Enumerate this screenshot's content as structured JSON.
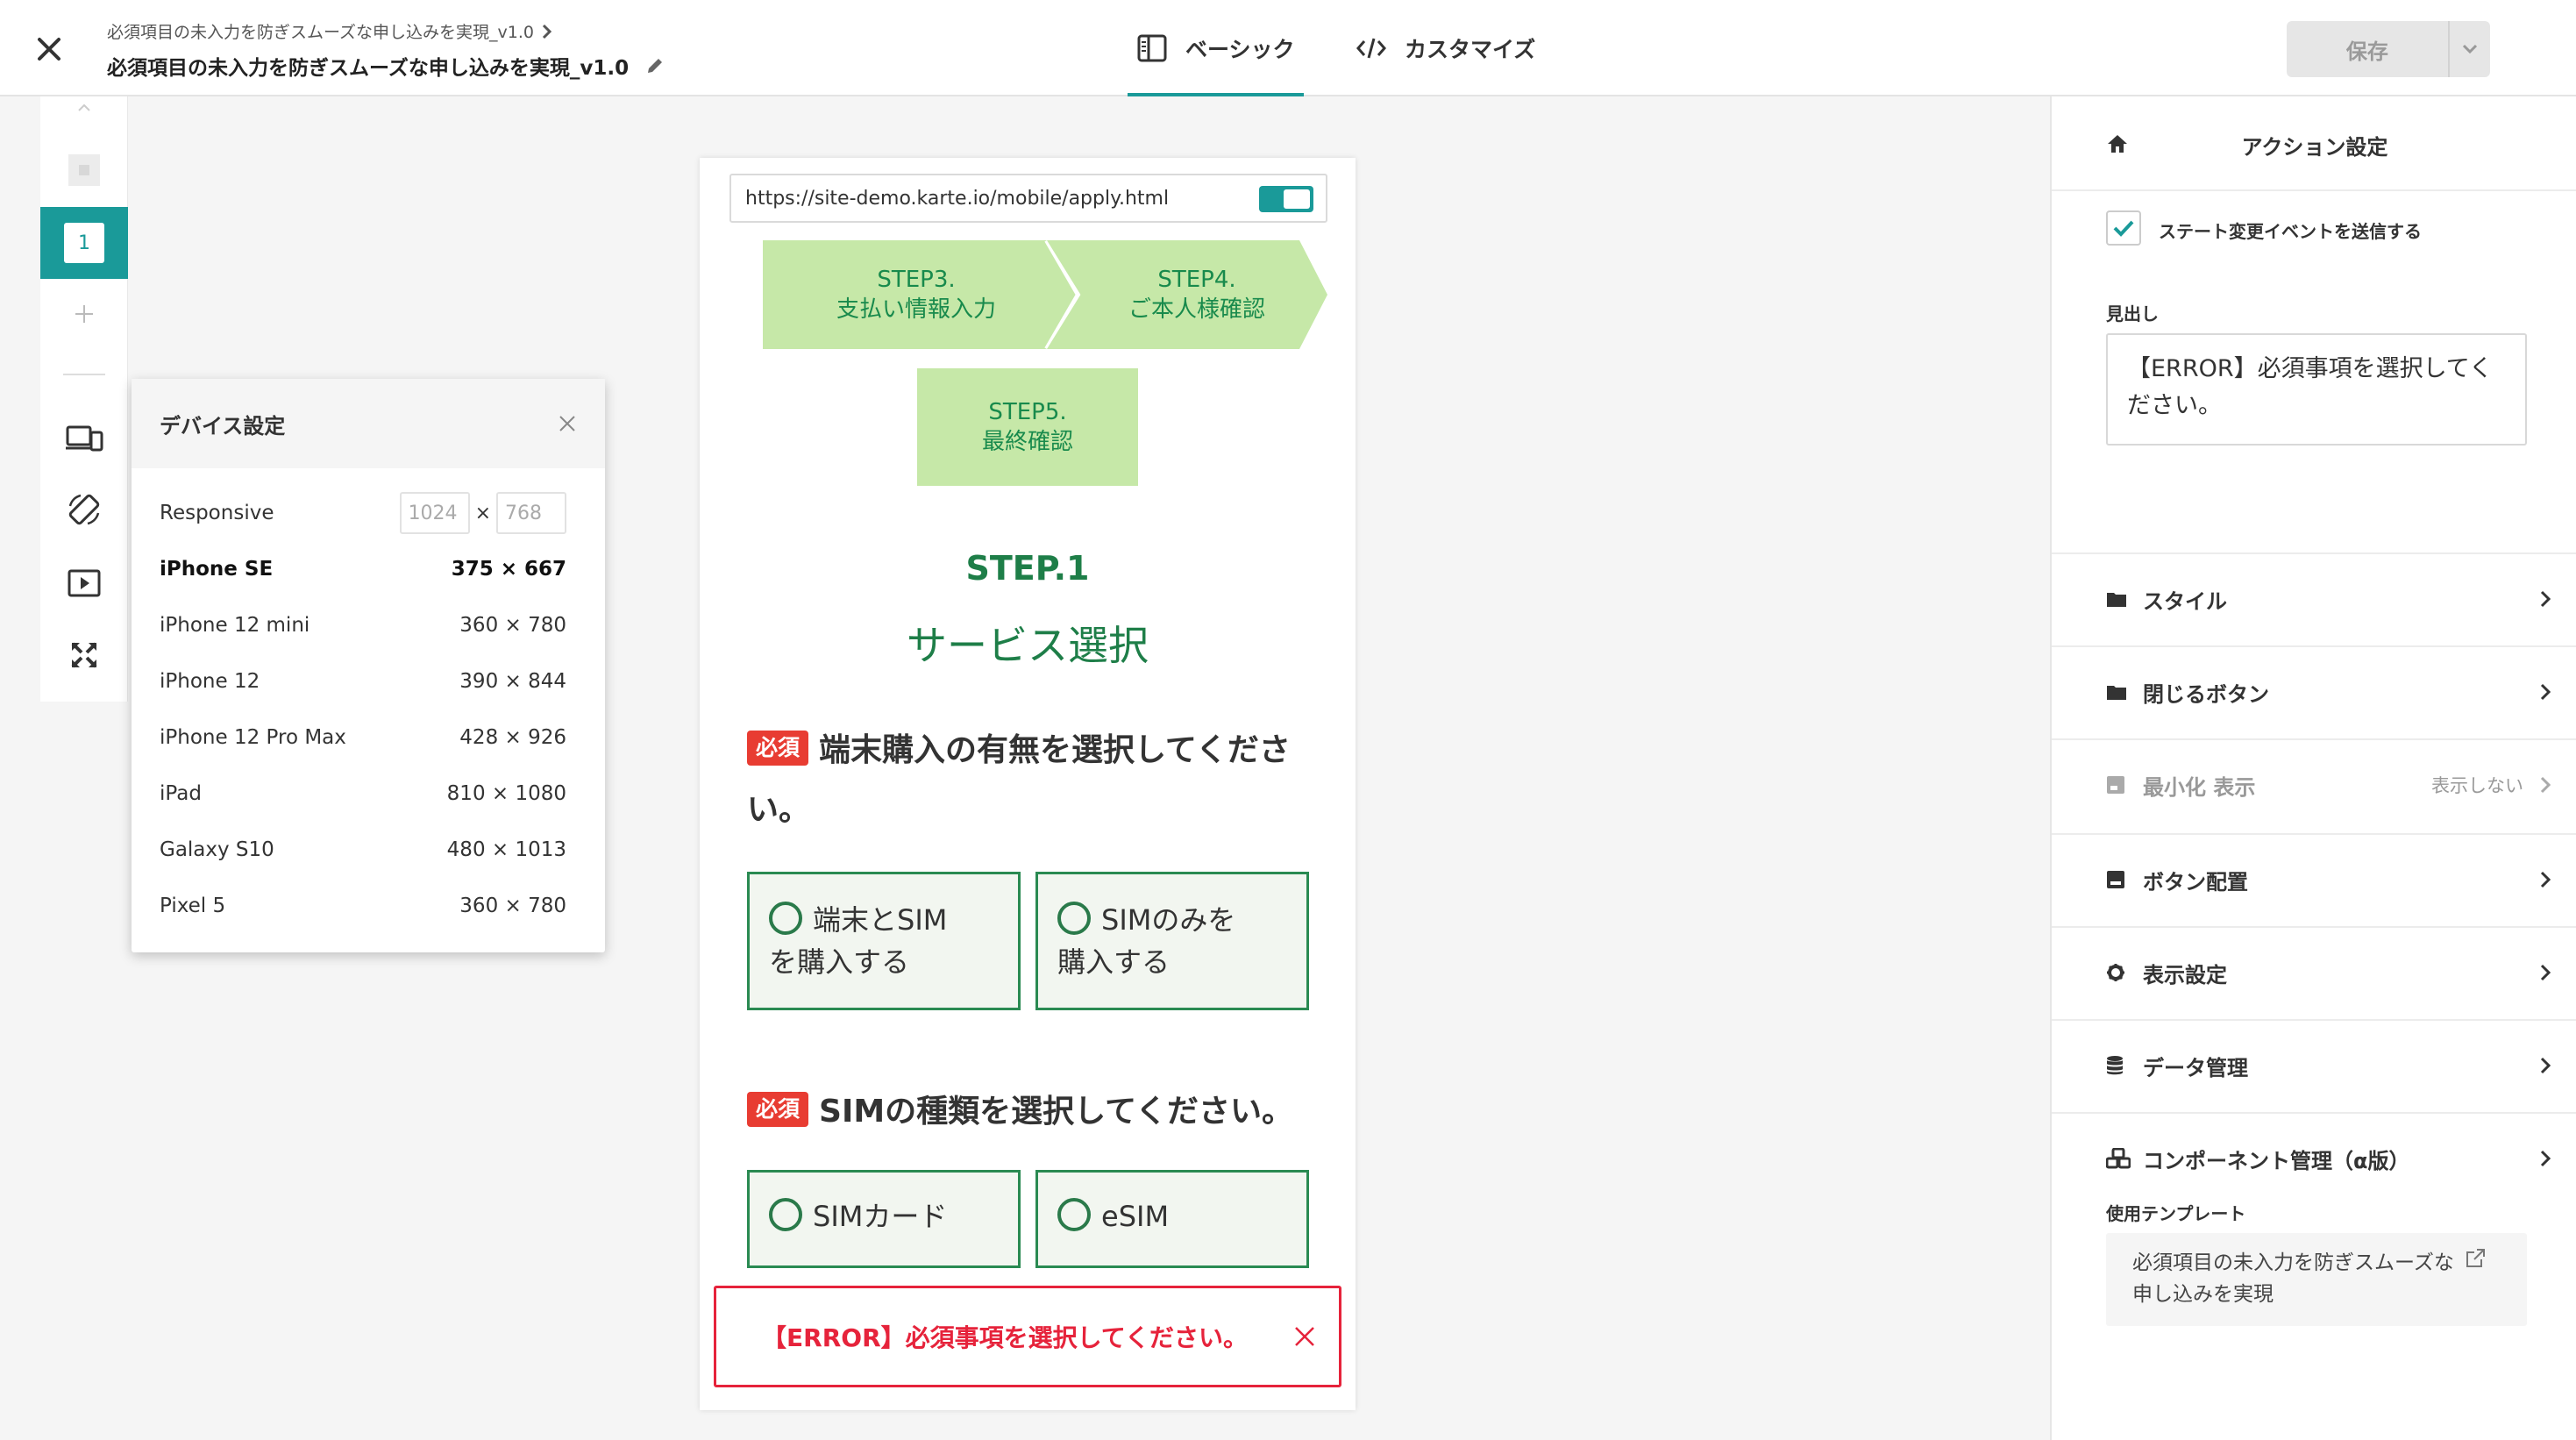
{
  "header": {
    "close_icon": "close-icon",
    "breadcrumb": "必須項目の未入力を防ぎスムーズな申し込みを実現_v1.0",
    "title": "必須項目の未入力を防ぎスムーズな申し込みを実現_v1.0",
    "tabs": [
      {
        "label": "ベーシック",
        "icon": "layout-icon",
        "active": true
      },
      {
        "label": "カスタマイズ",
        "icon": "code-icon",
        "active": false
      }
    ],
    "save_label": "保存"
  },
  "rail": {
    "page_number": "1"
  },
  "device_settings": {
    "title": "デバイス設定",
    "responsive": {
      "label": "Responsive",
      "width_placeholder": "1024",
      "separator": "×",
      "height_placeholder": "768"
    },
    "devices": [
      {
        "name": "iPhone SE",
        "size": "375 × 667",
        "selected": true
      },
      {
        "name": "iPhone 12 mini",
        "size": "360 × 780"
      },
      {
        "name": "iPhone 12",
        "size": "390 × 844"
      },
      {
        "name": "iPhone 12 Pro Max",
        "size": "428 × 926"
      },
      {
        "name": "iPad",
        "size": "810 × 1080"
      },
      {
        "name": "Galaxy S10",
        "size": "480 × 1013"
      },
      {
        "name": "Pixel 5",
        "size": "360 × 780"
      }
    ]
  },
  "preview": {
    "url": "https://site-demo.karte.io/mobile/apply.html",
    "steps": [
      {
        "num": "STEP3.",
        "label": "支払い情報入力"
      },
      {
        "num": "STEP4.",
        "label": "ご本人様確認"
      },
      {
        "num": "STEP5.",
        "label": "最終確認"
      }
    ],
    "step_title": "STEP.1",
    "step_subtitle": "サービス選択",
    "required_badge": "必須",
    "q1": {
      "text": "端末購入の有無を選択してください。",
      "options": [
        {
          "line1": "端末とSIM",
          "line2": "を購入する"
        },
        {
          "line1": "SIMのみを",
          "line2": "購入する"
        }
      ]
    },
    "q2": {
      "text": "SIMの種類を選択してください。",
      "options": [
        "SIMカード",
        "eSIM"
      ]
    },
    "error_message": "【ERROR】必須事項を選択してください。"
  },
  "right_panel": {
    "title": "アクション設定",
    "state_event_label": "ステート変更イベントを送信する",
    "state_event_checked": true,
    "heading_label": "見出し",
    "heading_value": "【ERROR】必須事項を選択してください。",
    "sections": [
      {
        "label": "スタイル",
        "icon": "folder-icon"
      },
      {
        "label": "閉じるボタン",
        "icon": "folder-icon"
      },
      {
        "label": "最小化 表示",
        "icon": "minimize-icon",
        "hint": "表示しない",
        "disabled": true
      },
      {
        "label": "ボタン配置",
        "icon": "button-layout-icon"
      },
      {
        "label": "表示設定",
        "icon": "gear-icon"
      },
      {
        "label": "データ管理",
        "icon": "database-icon"
      },
      {
        "label": "コンポーネント管理（α版）",
        "icon": "components-icon"
      }
    ],
    "template_label": "使用テンプレート",
    "template_name_line1": "必須項目の未入力を防ぎスムーズな",
    "template_name_line2": "申し込みを実現"
  },
  "colors": {
    "accent": "#1a9a99",
    "step_bg": "#c6e8a8",
    "required": "#e83c32",
    "error": "#e6233b",
    "option_border": "#2a8a52"
  }
}
